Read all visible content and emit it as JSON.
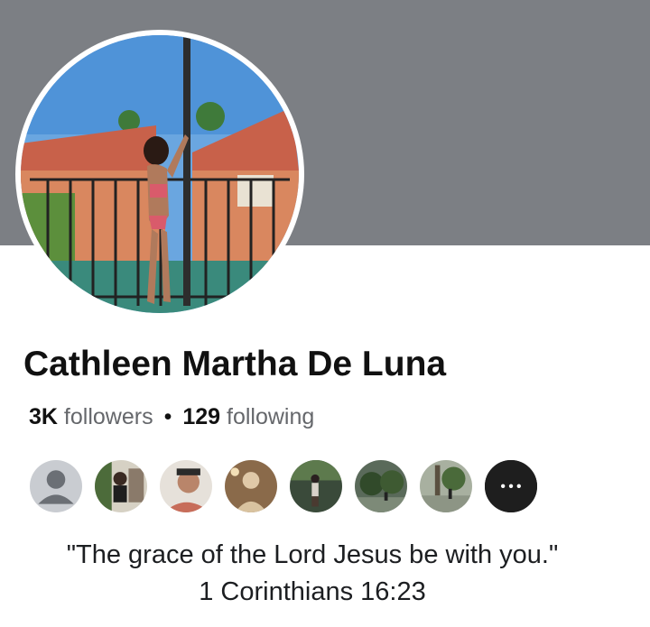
{
  "profile": {
    "name": "Cathleen Martha De Luna",
    "followers_count": "3K",
    "followers_label": "followers",
    "following_count": "129",
    "following_label": "following",
    "separator": "•",
    "bio_line1": "\"The grace of the Lord Jesus be with you.\"",
    "bio_line2": "1 Corinthians 16:23"
  },
  "followers_row": {
    "more_label": "•••",
    "avatars": [
      "default-avatar",
      "follower-avatar-1",
      "follower-avatar-2",
      "follower-avatar-3",
      "follower-avatar-4",
      "follower-avatar-5",
      "follower-avatar-6"
    ]
  },
  "colors": {
    "cover": "#7c7f84",
    "text_primary": "#111111",
    "text_secondary": "#65676b"
  }
}
